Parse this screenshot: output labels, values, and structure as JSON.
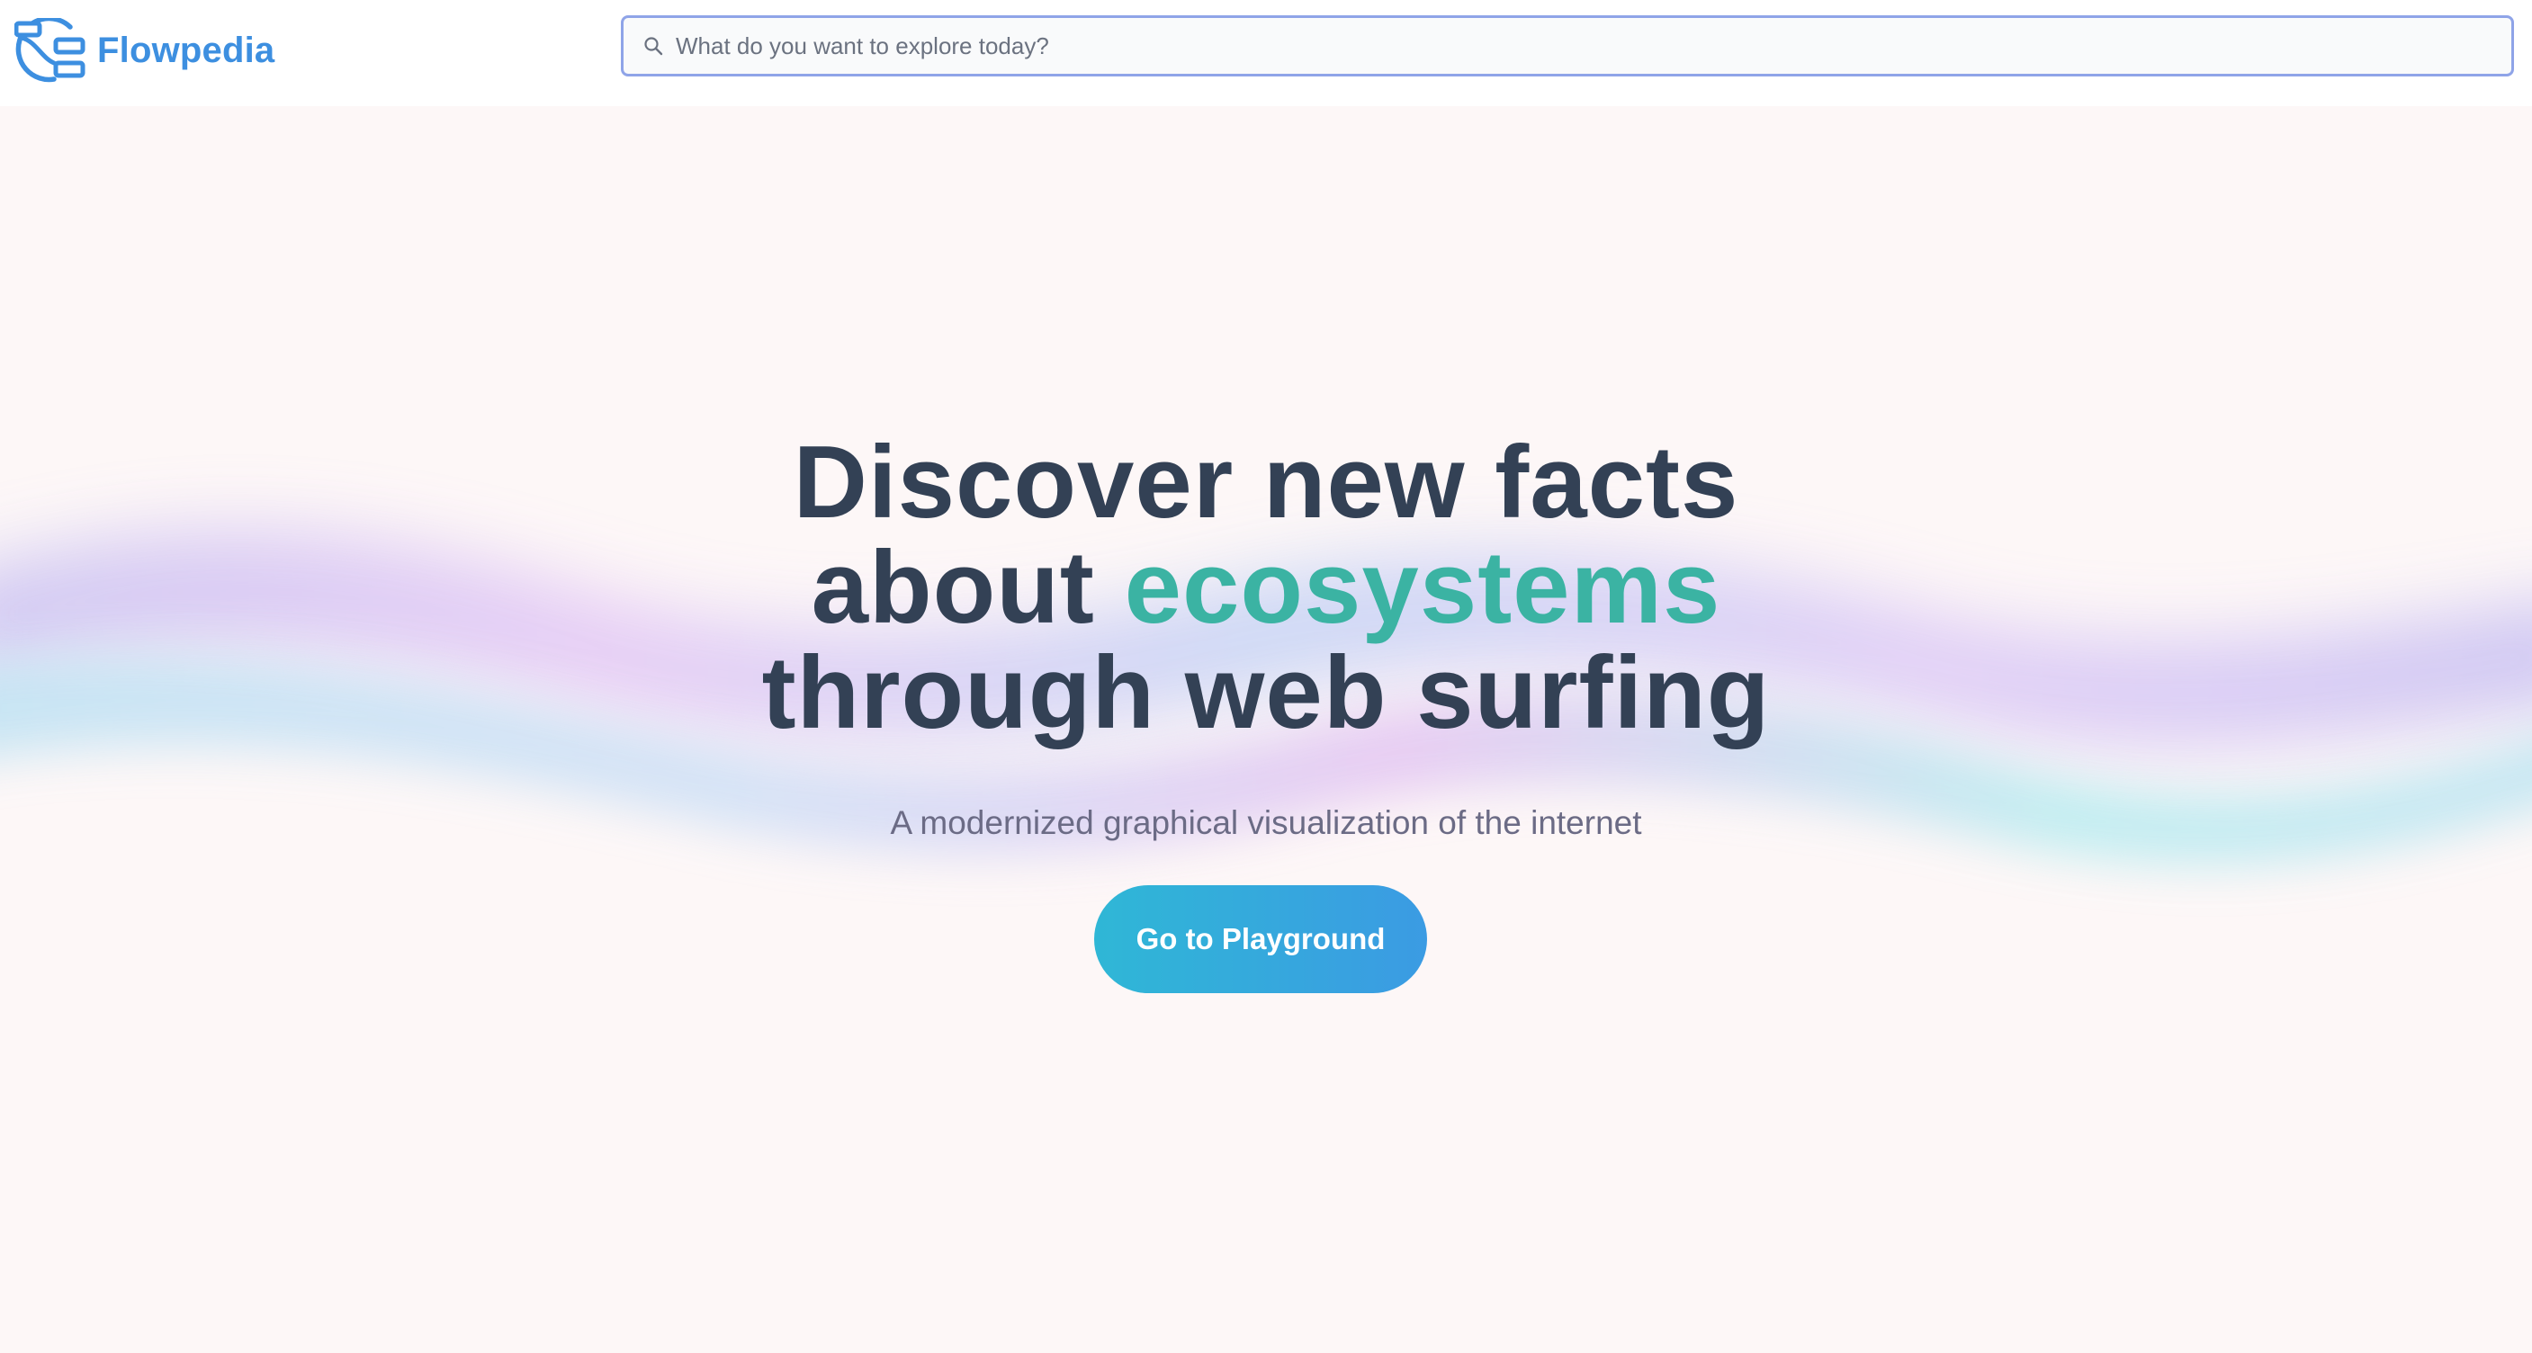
{
  "brand": {
    "name": "Flowpedia",
    "color": "#3d8fe0"
  },
  "search": {
    "placeholder": "What do you want to explore today?",
    "value": ""
  },
  "hero": {
    "headline": {
      "line1": "Discover new facts",
      "line2_prefix": "about ",
      "line2_accent": "ecosystems",
      "line3": "through web surfing"
    },
    "subtitle": "A modernized graphical visualization of the internet",
    "cta_label": "Go to Playground"
  },
  "colors": {
    "background": "#fdf7f7",
    "headline": "#334155",
    "accent": "#3bb3a3",
    "subtitle": "#6b6b85",
    "cta_gradient_start": "#2fb7d6",
    "cta_gradient_end": "#3b9be3",
    "search_border": "#8fa4e8"
  }
}
